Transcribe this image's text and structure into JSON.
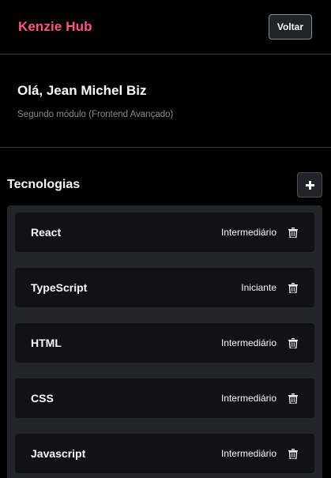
{
  "header": {
    "brand": "Kenzie Hub",
    "back_label": "Voltar"
  },
  "profile": {
    "greeting": "Olá, Jean Michel Biz",
    "module": "Segundo módulo (Frontend Avançado)"
  },
  "technologies": {
    "title": "Tecnologias",
    "add_icon": "plus-icon",
    "delete_icon": "trash-icon",
    "items": [
      {
        "name": "React",
        "status": "Intermediário"
      },
      {
        "name": "TypeScript",
        "status": "Iniciante"
      },
      {
        "name": "HTML",
        "status": "Intermediário"
      },
      {
        "name": "CSS",
        "status": "Intermediário"
      },
      {
        "name": "Javascript",
        "status": "Intermediário"
      }
    ]
  },
  "colors": {
    "brand": "#FF577F",
    "background": "#000000",
    "surface": "#212529",
    "card": "#121214",
    "text": "#F8F9FA",
    "muted": "#868E96"
  }
}
